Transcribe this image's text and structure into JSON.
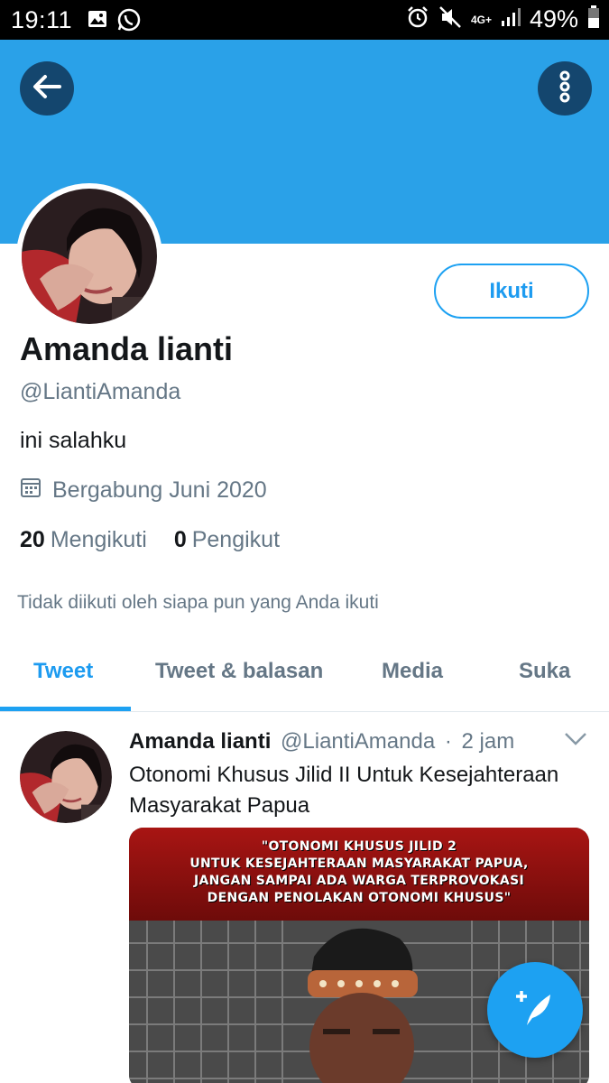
{
  "status_bar": {
    "time": "19:11",
    "battery": "49%",
    "network": "4G+"
  },
  "profile": {
    "display_name": "Amanda lianti",
    "handle": "@LiantiAmanda",
    "bio": "ini salahku",
    "joined": "Bergabung Juni 2020",
    "following_count": "20",
    "following_label": "Mengikuti",
    "followers_count": "0",
    "followers_label": "Pengikut",
    "not_followed_note": "Tidak diikuti oleh siapa pun yang Anda ikuti",
    "follow_button": "Ikuti"
  },
  "tabs": [
    {
      "label": "Tweet",
      "active": true
    },
    {
      "label": "Tweet & balasan",
      "active": false
    },
    {
      "label": "Media",
      "active": false
    },
    {
      "label": "Suka",
      "active": false
    }
  ],
  "tweet": {
    "author_name": "Amanda lianti",
    "author_handle": "@LiantiAmanda",
    "separator": "·",
    "time": "2 jam",
    "text": "Otonomi Khusus Jilid II Untuk Kesejahteraan Masyarakat Papua",
    "media_caption_lines": [
      "\"OTONOMI KHUSUS JILID 2",
      "UNTUK KESEJAHTERAAN MASYARAKAT PAPUA,",
      "JANGAN SAMPAI ADA WARGA TERPROVOKASI",
      "DENGAN PENOLAKAN OTONOMI KHUSUS\""
    ]
  },
  "colors": {
    "banner": "#2aa1e8",
    "accent": "#1da1f2",
    "circle_button": "#14466e"
  },
  "icons": {
    "back": "arrow-left-icon",
    "more": "more-vertical-icon",
    "calendar": "calendar-icon",
    "caret": "chevron-down-icon",
    "compose": "compose-tweet-icon"
  }
}
